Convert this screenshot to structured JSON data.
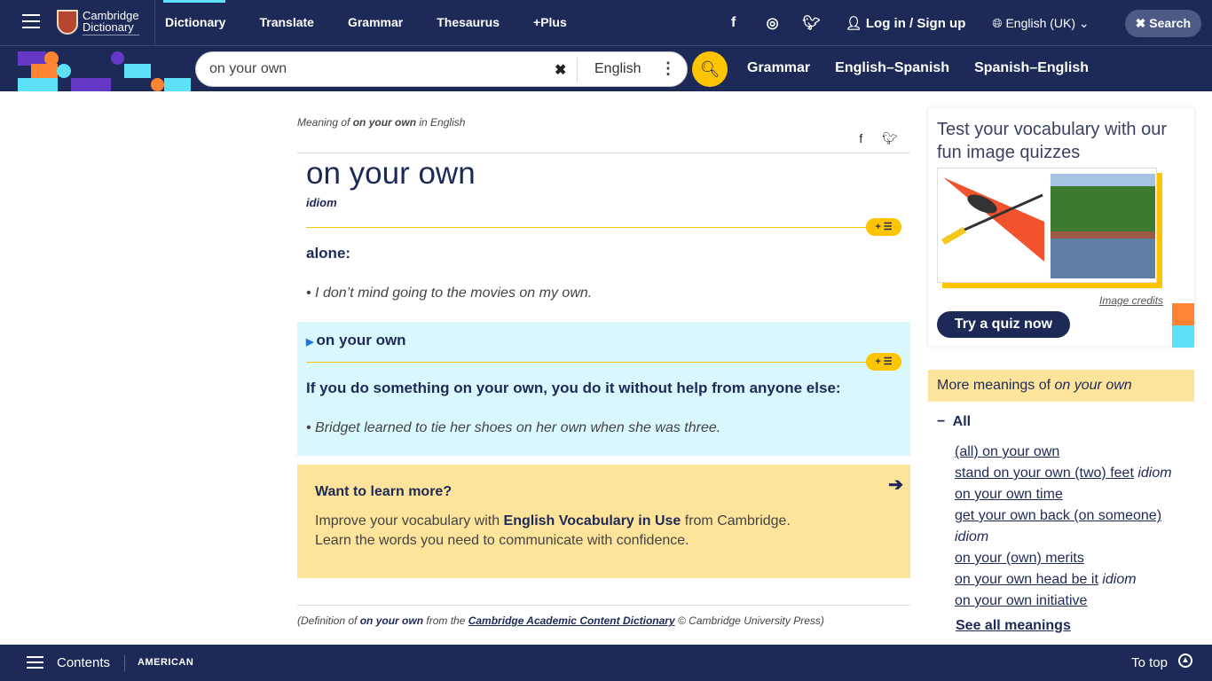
{
  "header": {
    "logo_line1": "Cambridge",
    "logo_line2": "Dictionary",
    "nav": [
      "Dictionary",
      "Translate",
      "Grammar",
      "Thesaurus",
      "+Plus"
    ],
    "login": "Log in / Sign up",
    "language": "English (UK)",
    "search_button": "Search"
  },
  "search": {
    "value": "on your own",
    "language": "English",
    "links": [
      "Grammar",
      "English–Spanish",
      "Spanish–English"
    ]
  },
  "entry": {
    "meaning_prefix": "Meaning of ",
    "meaning_word": "on your own",
    "meaning_suffix": " in English",
    "headword": "on your own",
    "pos": "idiom",
    "definition": "alone:",
    "example": "I don’t mind going to the movies on my own.",
    "plus_label": "+ ☰",
    "idiom": {
      "phrase": "on your own",
      "definition": "If you do something on your own, you do it without help from anyone else:",
      "example": "Bridget learned to tie her shoes on her own when she was three."
    }
  },
  "learn": {
    "title": "Want to learn more?",
    "line1_pre": "Improve your vocabulary with ",
    "line1_bold": "English Vocabulary in Use",
    "line1_post": " from Cambridge.",
    "line2": "Learn the words you need to communicate with confidence."
  },
  "credit": {
    "pre": "(Definition of ",
    "word": "on your own",
    "mid": " from the ",
    "source": "Cambridge Academic Content Dictionary",
    "post": " © Cambridge University Press)"
  },
  "quiz": {
    "title": "Test your vocabulary with our fun image quizzes",
    "image_credits": "Image credits",
    "button": "Try a quiz now"
  },
  "more": {
    "title_pre": "More meanings of ",
    "title_word": "on your own",
    "all": "All",
    "items": [
      {
        "text": "(all) on your own",
        "tag": ""
      },
      {
        "text": "stand on your own (two) feet",
        "tag": "idiom"
      },
      {
        "text": "on your own time",
        "tag": ""
      },
      {
        "text": "get your own back (on someone)",
        "tag": "idiom"
      },
      {
        "text": "on your (own) merits",
        "tag": ""
      },
      {
        "text": "on your own head be it",
        "tag": "idiom"
      },
      {
        "text": "on your own initiative",
        "tag": ""
      }
    ],
    "see_all": "See all meanings"
  },
  "footer": {
    "contents": "Contents",
    "dialect": "AMERICAN",
    "to_top": "To top"
  },
  "colors": {
    "navy": "#1d2a57",
    "yellow": "#fec400",
    "light_blue": "#d9f8fd",
    "pale_yellow": "#fee49a",
    "cyan": "#5ce1f9",
    "orange": "#fe8332",
    "purple": "#6538c5"
  }
}
